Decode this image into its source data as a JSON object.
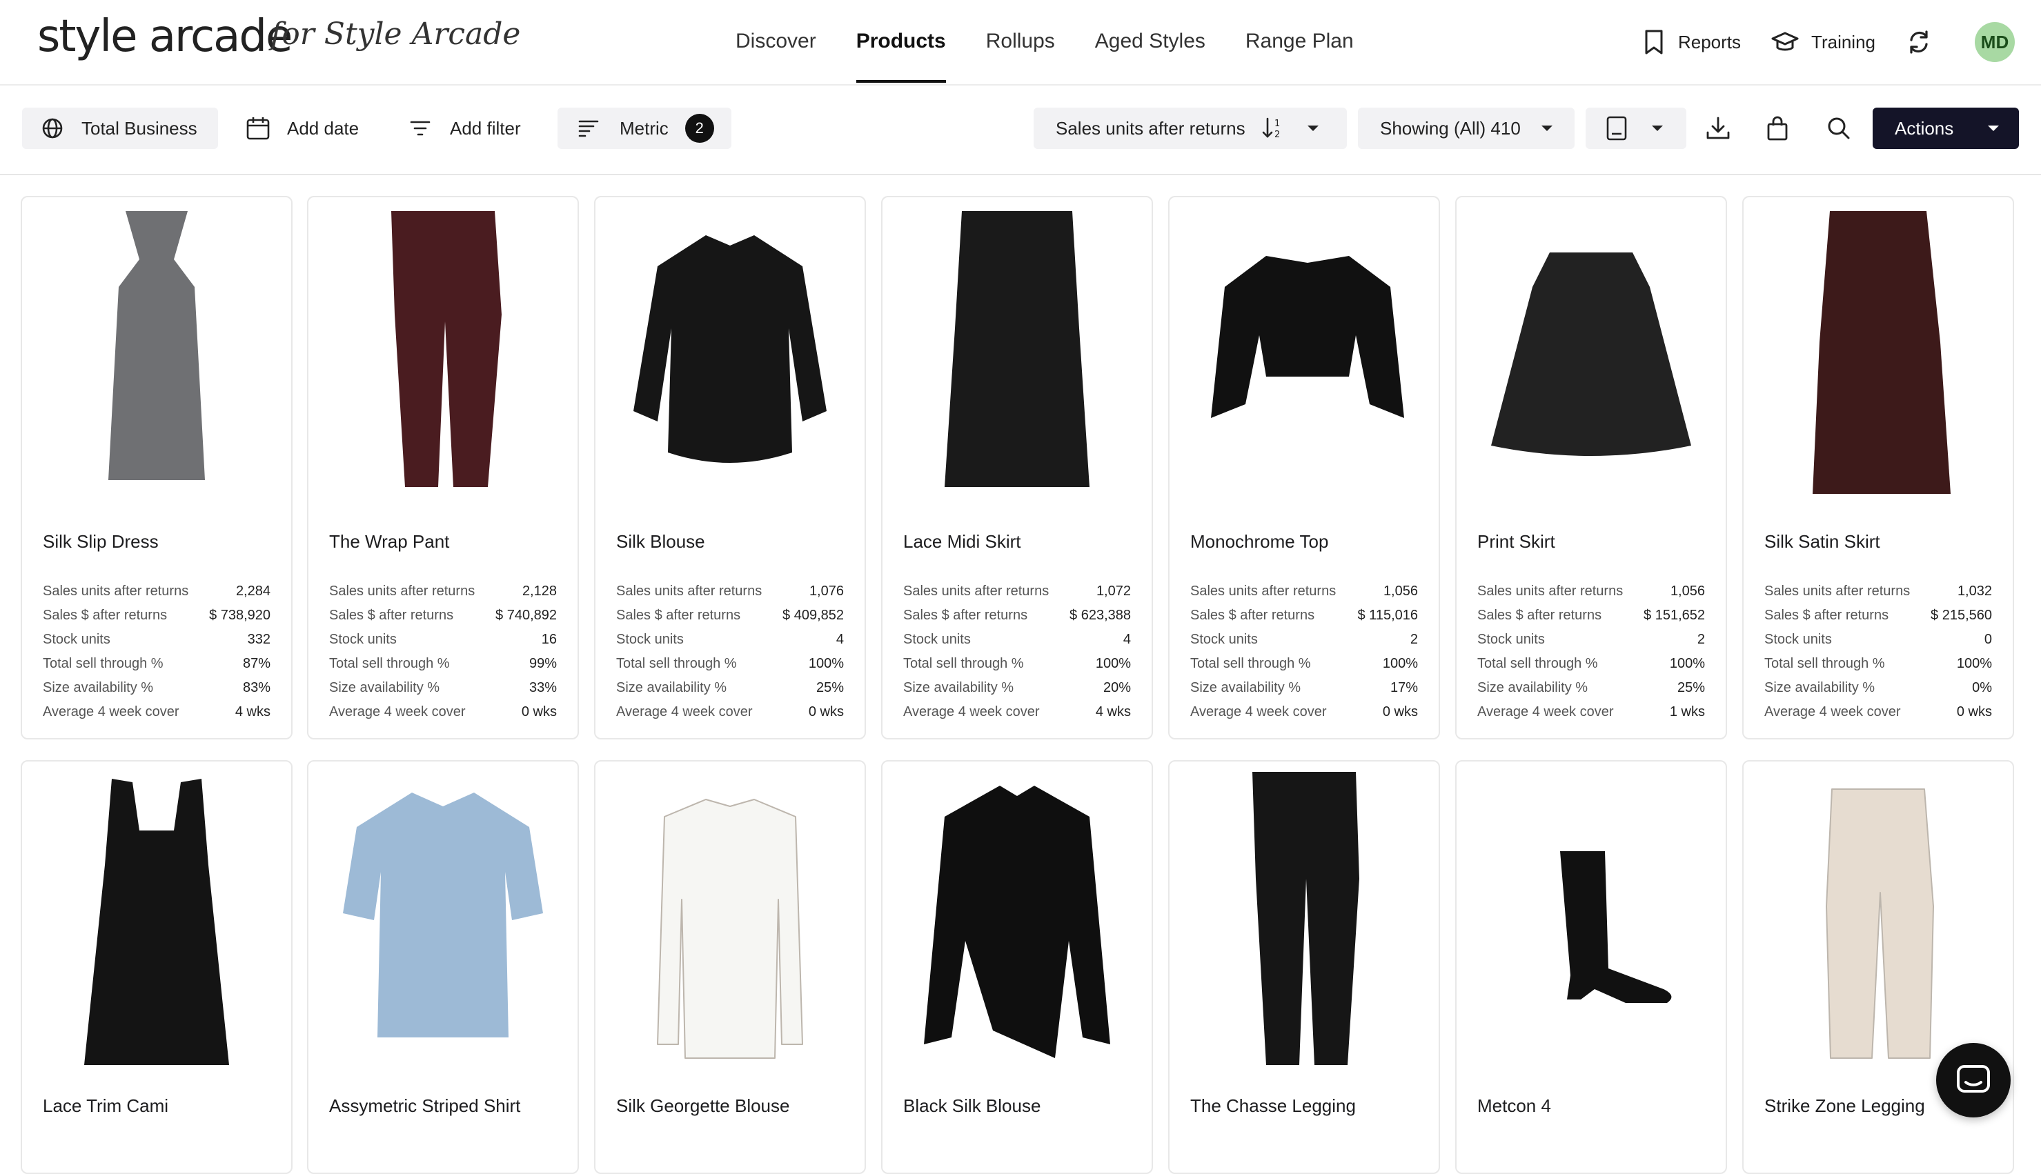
{
  "brand": {
    "logo": "style arcade",
    "subtitle": "for Style Arcade"
  },
  "nav": {
    "links": [
      "Discover",
      "Products",
      "Rollups",
      "Aged Styles",
      "Range Plan"
    ],
    "active": "Products"
  },
  "topright": {
    "reports": "Reports",
    "training": "Training",
    "avatar_initials": "MD",
    "avatar_color": "#a8d9a3"
  },
  "toolbar": {
    "total_business": "Total Business",
    "add_date": "Add date",
    "add_filter": "Add filter",
    "metric": "Metric",
    "metric_count": "2",
    "sort": "Sales units after returns",
    "showing": "Showing (All) 410",
    "actions": "Actions"
  },
  "stat_labels": [
    "Sales units after returns",
    "Sales $ after returns",
    "Stock units",
    "Total sell through %",
    "Size availability %",
    "Average 4 week cover"
  ],
  "products": [
    {
      "name": "Silk Slip Dress",
      "icon": "slip-dress-icon",
      "color": "#6f7073",
      "values": [
        "2,284",
        "$ 738,920",
        "332",
        "87%",
        "83%",
        "4 wks"
      ]
    },
    {
      "name": "The Wrap Pant",
      "icon": "pant-icon",
      "color": "#4a1c20",
      "values": [
        "2,128",
        "$ 740,892",
        "16",
        "99%",
        "33%",
        "0 wks"
      ]
    },
    {
      "name": "Silk Blouse",
      "icon": "blouse-icon",
      "color": "#161616",
      "values": [
        "1,076",
        "$ 409,852",
        "4",
        "100%",
        "25%",
        "0 wks"
      ]
    },
    {
      "name": "Lace Midi Skirt",
      "icon": "pencil-skirt-icon",
      "color": "#1a1a1a",
      "values": [
        "1,072",
        "$ 623,388",
        "4",
        "100%",
        "20%",
        "4 wks"
      ]
    },
    {
      "name": "Monochrome Top",
      "icon": "crop-top-icon",
      "color": "#111111",
      "values": [
        "1,056",
        "$ 115,016",
        "2",
        "100%",
        "17%",
        "0 wks"
      ]
    },
    {
      "name": "Print Skirt",
      "icon": "aline-skirt-icon",
      "color": "#222222",
      "values": [
        "1,056",
        "$ 151,652",
        "2",
        "100%",
        "25%",
        "1 wks"
      ]
    },
    {
      "name": "Silk Satin Skirt",
      "icon": "maxi-skirt-icon",
      "color": "#3d1a1a",
      "values": [
        "1,032",
        "$ 215,560",
        "0",
        "100%",
        "0%",
        "0 wks"
      ]
    },
    {
      "name": "Lace Trim Cami",
      "icon": "cami-icon",
      "color": "#141414"
    },
    {
      "name": "Assymetric Striped Shirt",
      "icon": "denim-shirt-icon",
      "color": "#9dbad6"
    },
    {
      "name": "Silk Georgette Blouse",
      "icon": "bow-blouse-icon",
      "color": "#f6f6f3"
    },
    {
      "name": "Black Silk Blouse",
      "icon": "ruffle-blouse-icon",
      "color": "#0f0f0f"
    },
    {
      "name": "The Chasse Legging",
      "icon": "leather-pant-icon",
      "color": "#161616"
    },
    {
      "name": "Metcon 4",
      "icon": "boot-icon",
      "color": "#111111"
    },
    {
      "name": "Strike Zone Legging",
      "icon": "trouser-icon",
      "color": "#e6dcd0"
    }
  ]
}
